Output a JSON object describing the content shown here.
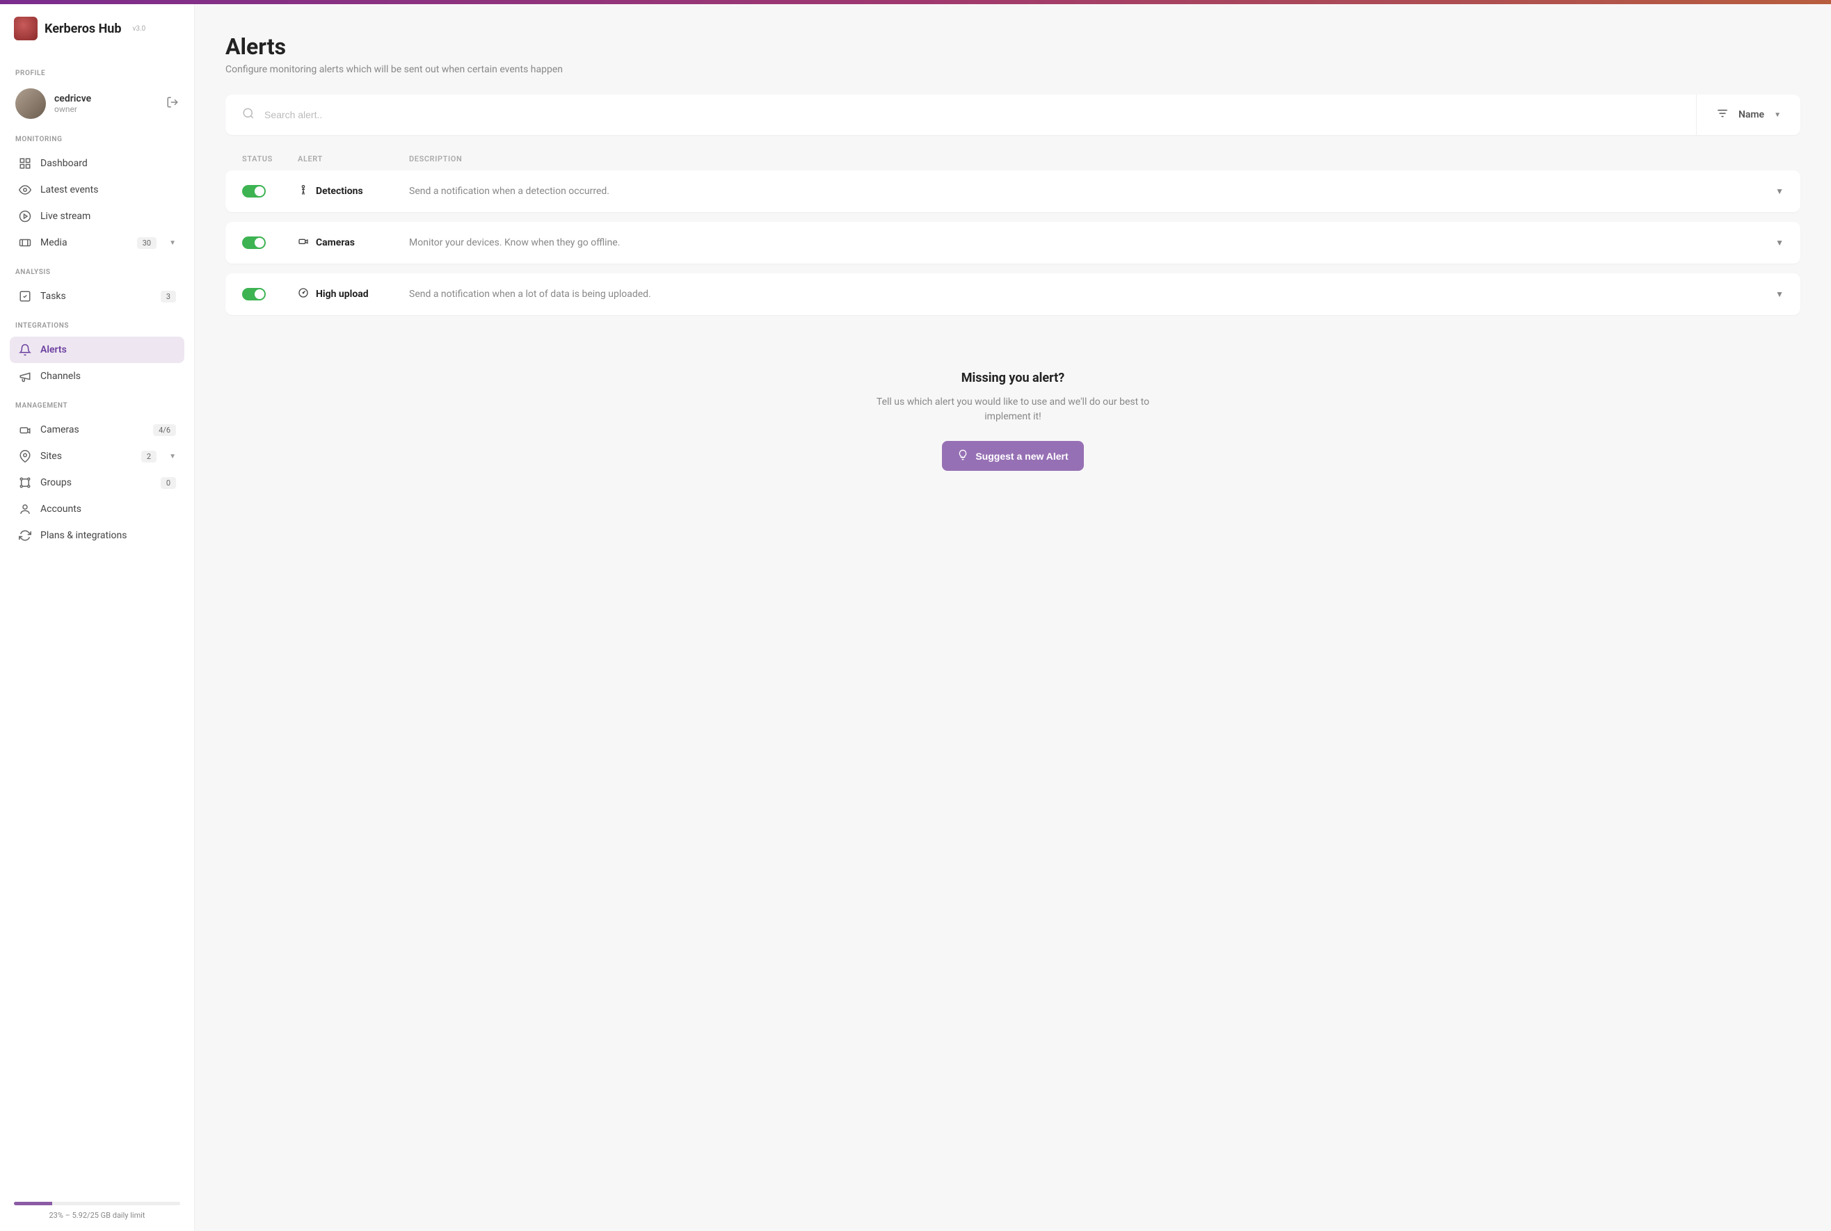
{
  "app": {
    "name": "Kerberos Hub",
    "version": "v3.0"
  },
  "sidebar": {
    "sections": {
      "profile": "PROFILE",
      "monitoring": "MONITORING",
      "analysis": "ANALYSIS",
      "integrations": "INTEGRATIONS",
      "management": "MANAGEMENT"
    },
    "user": {
      "name": "cedricve",
      "role": "owner"
    },
    "monitoring": [
      {
        "label": "Dashboard"
      },
      {
        "label": "Latest events"
      },
      {
        "label": "Live stream"
      },
      {
        "label": "Media",
        "badge": "30",
        "chev": true
      }
    ],
    "analysis": [
      {
        "label": "Tasks",
        "badge": "3"
      }
    ],
    "integrations": [
      {
        "label": "Alerts",
        "active": true
      },
      {
        "label": "Channels"
      }
    ],
    "management": [
      {
        "label": "Cameras",
        "badge": "4/6"
      },
      {
        "label": "Sites",
        "badge": "2",
        "chev": true
      },
      {
        "label": "Groups",
        "badge": "0"
      },
      {
        "label": "Accounts"
      },
      {
        "label": "Plans & integrations"
      }
    ],
    "usage": {
      "percent": 23,
      "text": "23% – 5.92/25 GB daily limit"
    }
  },
  "page": {
    "title": "Alerts",
    "subtitle": "Configure monitoring alerts which will be sent out when certain events happen",
    "search_placeholder": "Search alert..",
    "sort_label": "Name",
    "columns": {
      "status": "STATUS",
      "alert": "ALERT",
      "description": "DESCRIPTION"
    },
    "alerts": [
      {
        "icon": "person-icon",
        "title": "Detections",
        "description": "Send a notification when a detection occurred."
      },
      {
        "icon": "camera-icon",
        "title": "Cameras",
        "description": "Monitor your devices. Know when they go offline."
      },
      {
        "icon": "gauge-icon",
        "title": "High upload",
        "description": "Send a notification when a lot of data is being uploaded."
      }
    ],
    "missing": {
      "title": "Missing you alert?",
      "body": "Tell us which alert you would like to use and we'll do our best to implement it!",
      "button": "Suggest a new Alert"
    }
  }
}
